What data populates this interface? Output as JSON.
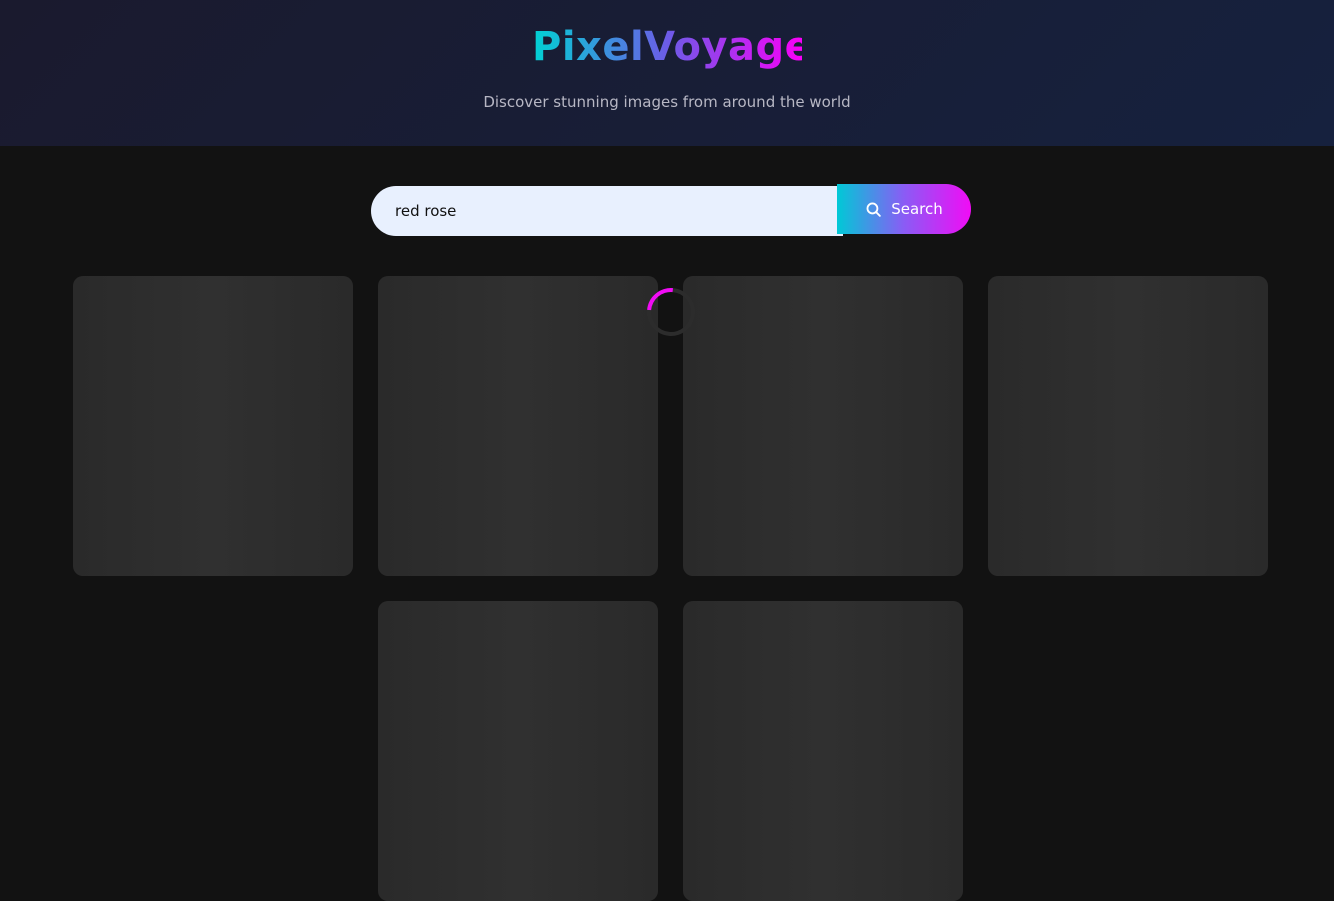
{
  "header": {
    "logo": "PixelVoyage",
    "tagline": "Discover stunning images from around the world"
  },
  "search": {
    "value": "red rose",
    "button_label": "Search",
    "icon": "search-icon"
  },
  "colors": {
    "header_bg": "#1a1a2e",
    "page_bg": "#121212",
    "accent_start": "#00d2d3",
    "accent_mid": "#6c5ce7",
    "accent_end": "#f800f8",
    "card_placeholder": "#2d2d2d",
    "spinner": "#f10cf5"
  },
  "gallery": {
    "loading": true,
    "placeholder_count": 6
  }
}
